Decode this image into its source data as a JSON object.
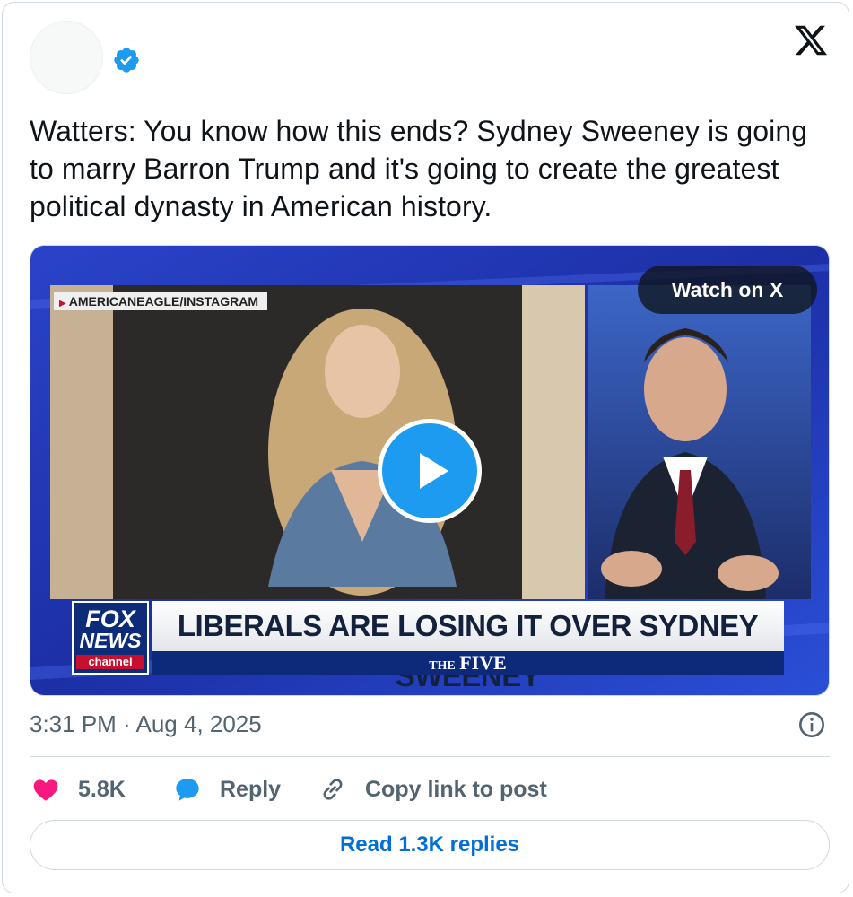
{
  "post": {
    "text": "Watters: You know how this ends? Sydney Sweeney is going to marry Barron Trump and it's going to create the greatest political dynasty in American history.",
    "timestamp": "3:31 PM · Aug 4, 2025"
  },
  "media": {
    "watch_label": "Watch on X",
    "photo_credit": "AMERICANEAGLE/INSTAGRAM",
    "headline": "LIBERALS ARE LOSING IT OVER SYDNEY SWEENEY",
    "show_prefix": "THE",
    "show_name": "FIVE",
    "logo_top": "FOX",
    "logo_middle": "NEWS",
    "logo_bottom": "channel"
  },
  "actions": {
    "likes": "5.8K",
    "reply_label": "Reply",
    "copy_label": "Copy link to post"
  },
  "footer": {
    "read_replies_label": "Read 1.3K replies"
  },
  "colors": {
    "accent": "#1d9bf0",
    "heart": "#f91880",
    "link": "#006fd6",
    "muted": "#536471"
  },
  "icons": [
    "verified-badge-icon",
    "x-logo-icon",
    "play-icon",
    "info-icon",
    "heart-icon",
    "reply-bubble-icon",
    "link-icon"
  ]
}
